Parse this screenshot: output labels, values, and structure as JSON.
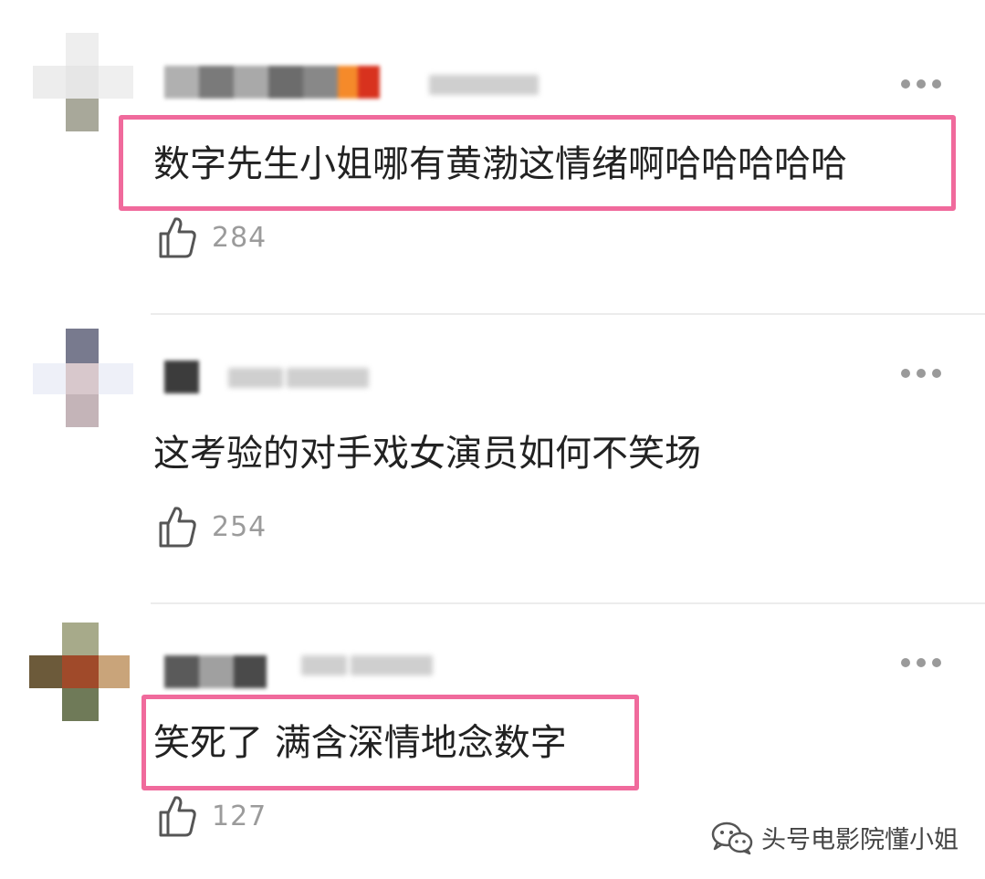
{
  "comments": [
    {
      "text": "数字先生小姐哪有黄渤这情绪啊哈哈哈哈哈",
      "likes": "284",
      "highlighted": true
    },
    {
      "text": "这考验的对手戏女演员如何不笑场",
      "likes": "254",
      "highlighted": false
    },
    {
      "text": "笑死了 满含深情地念数字",
      "likes": "127",
      "highlighted": true
    }
  ],
  "watermark": {
    "text": "头号电影院懂小姐",
    "icon": "wechat-icon"
  },
  "colors": {
    "highlight": "#f06a9c",
    "like_count": "#9b9b9b",
    "divider": "#ececec"
  },
  "icons": {
    "like": "thumbs-up-icon",
    "more": "more-dots-icon"
  }
}
